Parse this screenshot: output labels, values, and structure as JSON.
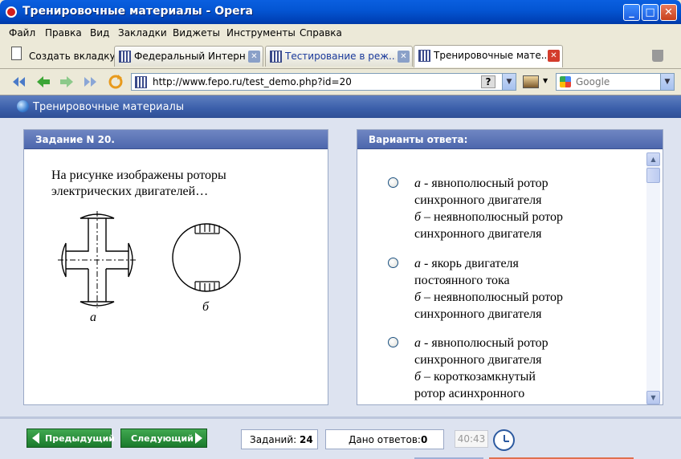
{
  "window": {
    "title": "Тренировочные материалы - Opera"
  },
  "menu": [
    "Файл",
    "Правка",
    "Вид",
    "Закладки",
    "Виджеты",
    "Инструменты",
    "Справка"
  ],
  "tabs": {
    "new_tab_label": "Создать вкладку",
    "items": [
      {
        "label": "Федеральный Интерн..."
      },
      {
        "label": "Тестирование в реж..."
      },
      {
        "label": "Тренировочные мате..."
      }
    ],
    "close_glyph": "✕"
  },
  "address": {
    "url": "http://www.fepo.ru/test_demo.php?id=20",
    "help_glyph": "?",
    "search_placeholder": "Google",
    "drop_glyph": "▼"
  },
  "page": {
    "header_title": "Тренировочные материалы",
    "task_panel_title": "Задание N 20.",
    "answers_panel_title": "Варианты ответа:",
    "question_text": "На рисунке изображены роторы электрических двигателей…",
    "figure_labels": {
      "a": "а",
      "b": "б"
    },
    "options": [
      {
        "line1_italic": "а",
        "line1": " - явнополюсный ротор",
        "line2": "синхронного двигателя",
        "line3_italic": "б",
        "line3": " – неявнополюсный ротор",
        "line4": "синхронного двигателя"
      },
      {
        "line1_italic": "а",
        "line1": " - якорь двигателя",
        "line2": "постоянного тока",
        "line3_italic": "б",
        "line3": " – неявнополюсный ротор",
        "line4": "синхронного двигателя"
      },
      {
        "line1_italic": "а",
        "line1": " - явнополюсный ротор",
        "line2": "синхронного двигателя",
        "line3_italic": "б",
        "line3": " – короткозамкнутый",
        "line4": "ротор асинхронного"
      }
    ]
  },
  "footer": {
    "prev_label": "Предыдущий",
    "next_label": "Следующий",
    "tasks_label": "Заданий:",
    "tasks_count": "24",
    "answers_label": "Дано ответов:",
    "answers_count": "0",
    "timer": "40:43"
  },
  "colors": {
    "accent": "#3a5ea9",
    "nav_button": "#2a8a3c",
    "titlebar": "#0456d4"
  }
}
